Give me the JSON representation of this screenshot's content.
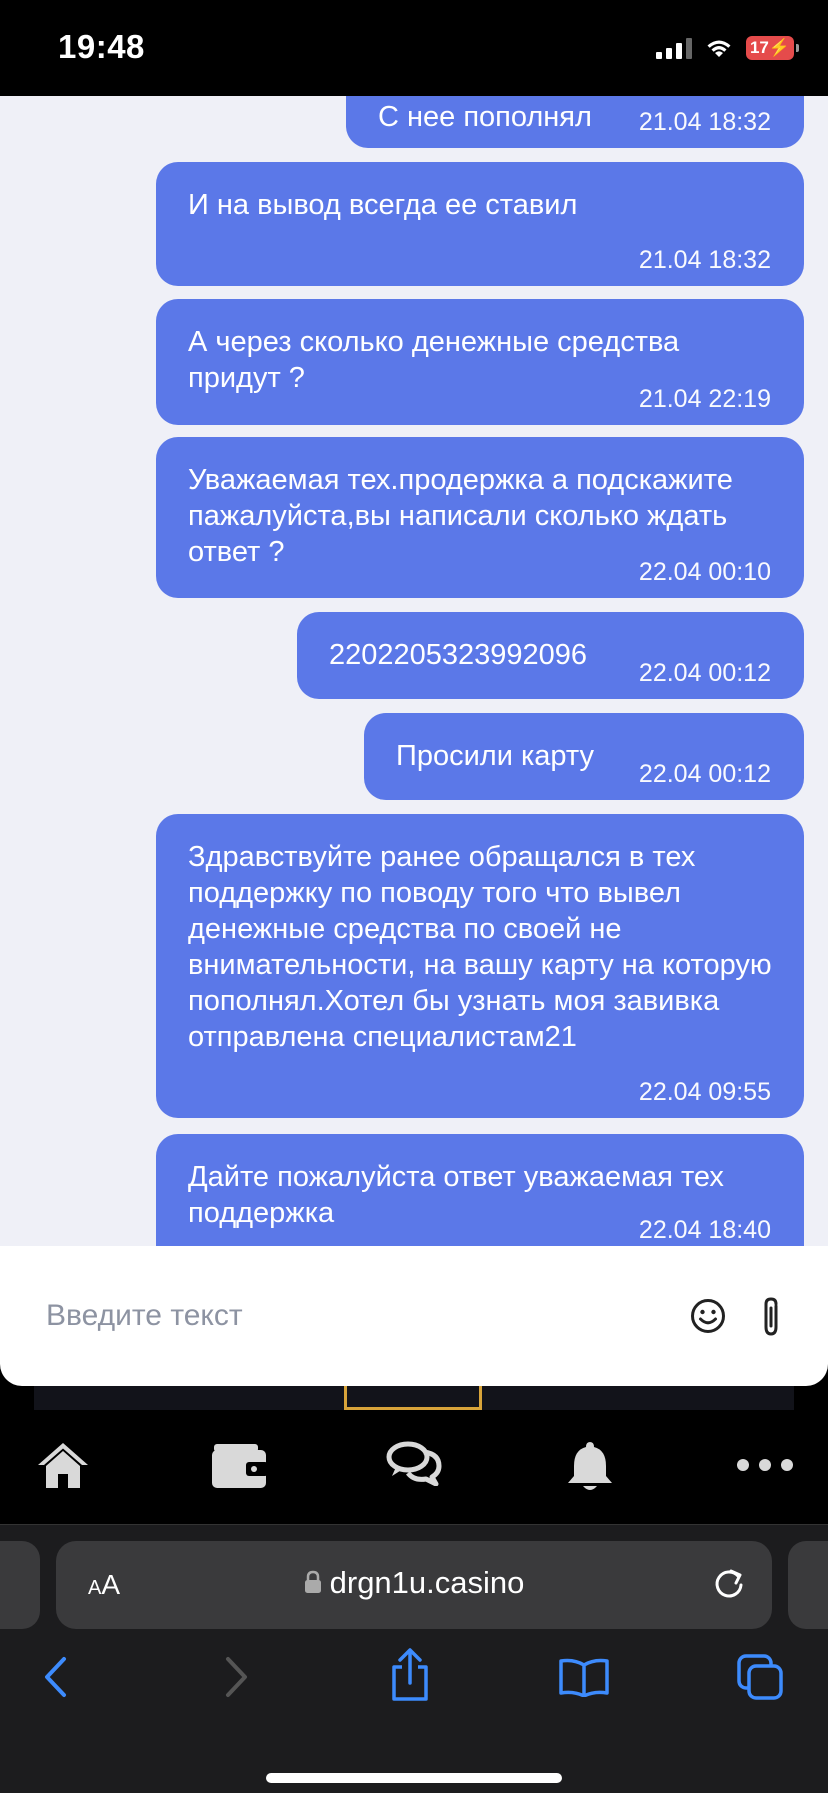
{
  "status_bar": {
    "time": "19:48",
    "battery": "17"
  },
  "chat": {
    "messages": [
      {
        "text": "С нее пополнял",
        "time": "21.04 18:32"
      },
      {
        "text": "И на вывод всегда ее ставил",
        "time": "21.04 18:32"
      },
      {
        "text": "А через сколько денежные средства придут ?",
        "time": "21.04 22:19"
      },
      {
        "text": "Уважаемая тех.продержка а подскажите пажалуйста,вы написали сколько ждать ответ ?",
        "time": "22.04 00:10"
      },
      {
        "text": "2202205323992096",
        "time": "22.04 00:12"
      },
      {
        "text": "Просили карту",
        "time": "22.04 00:12"
      },
      {
        "text": "Здравствуйте ранее обращался в тех поддержку по поводу того что вывел денежные средства по своей не внимательности, на вашу карту на которую пополнял.Хотел бы узнать моя завивка отправлена специалистам21",
        "time": "22.04 09:55"
      },
      {
        "text": "Дайте пожалуйста ответ уважаемая тех поддержка",
        "time": "22.04 18:40"
      }
    ]
  },
  "composer": {
    "placeholder": "Введите текст",
    "emoji_icon": "smiley-icon",
    "attach_icon": "paperclip-icon"
  },
  "nav": {
    "items": [
      "home-icon",
      "wallet-icon",
      "chat-bubbles-icon",
      "bell-icon",
      "more-icon"
    ]
  },
  "browser": {
    "aa_small": "A",
    "aa_large": "A",
    "url": "drgn1u.casino"
  },
  "colors": {
    "bubble": "#5b78e8",
    "chat_bg": "#eff0f7",
    "accent_blue": "#3d8bfd"
  }
}
